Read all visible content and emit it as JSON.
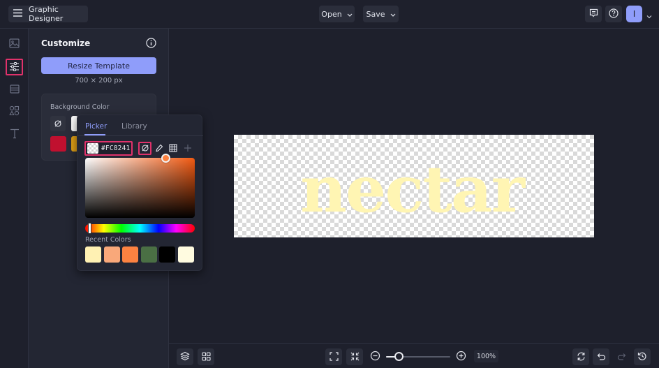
{
  "topbar": {
    "app_title": "Graphic Designer",
    "open_label": "Open",
    "save_label": "Save",
    "avatar_initial": "I"
  },
  "left_rail": {
    "items": [
      {
        "name": "image",
        "active": false
      },
      {
        "name": "customize",
        "active": true
      },
      {
        "name": "layout",
        "active": false
      },
      {
        "name": "graphics",
        "active": false
      },
      {
        "name": "text",
        "active": false
      }
    ]
  },
  "panel": {
    "title": "Customize",
    "resize_label": "Resize Template",
    "dimensions": "700 × 200 px",
    "background_color_label": "Background Color",
    "background_swatches": [
      "#ffffff",
      "#c0102f",
      "#e0a017"
    ]
  },
  "color_popover": {
    "tabs": [
      {
        "label": "Picker",
        "active": true
      },
      {
        "label": "Library",
        "active": false
      }
    ],
    "hex_value": "#FC8241",
    "tools": [
      "no-color",
      "eyedropper",
      "grid",
      "add"
    ],
    "recent_label": "Recent Colors",
    "recent_colors": [
      "#fff1b3",
      "#f9a87a",
      "#fc8241",
      "#4a6f44",
      "#000000",
      "#fffbe0"
    ],
    "hue_fraction": 0.04
  },
  "canvas": {
    "text": "nectar",
    "text_color": "#fff5b3"
  },
  "bottombar": {
    "zoom_percent": "100%",
    "zoom_fraction": 0.2
  },
  "colors": {
    "accent": "#8f9dfa",
    "highlight": "#e0326b",
    "selected_color": "#FC8241"
  }
}
